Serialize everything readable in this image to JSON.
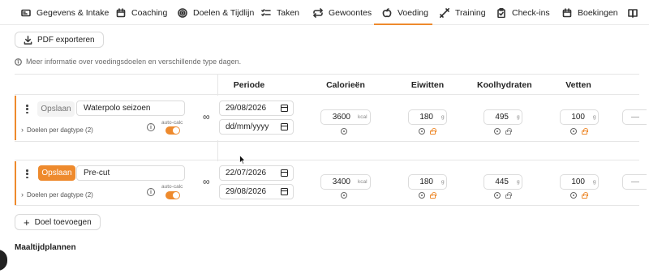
{
  "tabs": [
    {
      "label": "Gegevens & Intake",
      "icon": "id-card-icon"
    },
    {
      "label": "Coaching",
      "icon": "calendar-icon"
    },
    {
      "label": "Doelen & Tijdlijn",
      "icon": "target-icon"
    },
    {
      "label": "Taken",
      "icon": "checklist-icon"
    },
    {
      "label": "Gewoontes",
      "icon": "repeat-icon"
    },
    {
      "label": "Voeding",
      "icon": "apple-icon"
    },
    {
      "label": "Training",
      "icon": "dumbbell-icon"
    },
    {
      "label": "Check-ins",
      "icon": "clipboard-check-icon"
    },
    {
      "label": "Boekingen",
      "icon": "calendar-icon"
    }
  ],
  "active_tab": "Voeding",
  "toolbar": {
    "export_label": "PDF exporteren"
  },
  "info_text": "Meer informatie over voedingsdoelen en verschillende type dagen.",
  "table": {
    "headers": {
      "periode": "Periode",
      "calorieen": "Calorieën",
      "eiwitten": "Eiwitten",
      "koolhydraten": "Koolhydraten",
      "vetten": "Vetten"
    },
    "rows": [
      {
        "save_label": "Opslaan",
        "save_state": "disabled",
        "name": "Waterpolo seizoen",
        "daytype_label": "Doelen per dagtype (2)",
        "autocalc_label": "auto-calc",
        "autocalc_on": true,
        "date_start": "29/08/2026",
        "date_end": "dd/mm/yyyy",
        "calories": "3600",
        "calories_unit": "kcal",
        "protein": "180",
        "protein_unit": "g",
        "carbs": "495",
        "carbs_unit": "g",
        "fat": "100",
        "fat_unit": "g",
        "extra": "—"
      },
      {
        "save_label": "Opslaan",
        "save_state": "primary",
        "name": "Pre-cut",
        "daytype_label": "Doelen per dagtype (2)",
        "autocalc_label": "auto-calc",
        "autocalc_on": true,
        "date_start": "22/07/2026",
        "date_end": "29/08/2026",
        "calories": "3400",
        "calories_unit": "kcal",
        "protein": "180",
        "protein_unit": "g",
        "carbs": "445",
        "carbs_unit": "g",
        "fat": "100",
        "fat_unit": "g",
        "extra": "—"
      }
    ]
  },
  "add_goal_label": "Doel toevoegen",
  "section_title": "Maaltijdplannen",
  "colors": {
    "accent": "#ee8a2d"
  }
}
